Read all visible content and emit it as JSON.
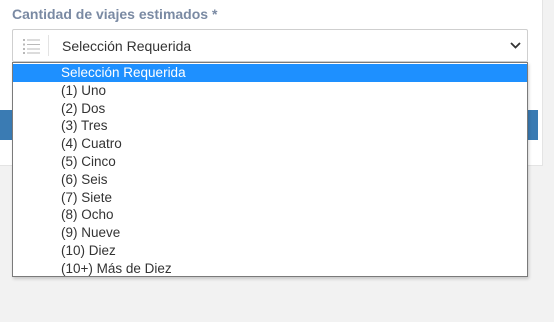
{
  "form": {
    "label": "Cantidad de viajes estimados *",
    "select": {
      "value": "Selección Requerida",
      "icon": "list-icon",
      "options": [
        "Selección Requerida",
        "(1) Uno",
        "(2) Dos",
        "(3) Tres",
        "(4) Cuatro",
        "(5) Cinco",
        "(6) Seis",
        "(7) Siete",
        "(8) Ocho",
        "(9) Nueve",
        "(10) Diez",
        "(10+) Más de Diez"
      ],
      "highlighted_index": 0
    }
  },
  "colors": {
    "highlight": "#1e90ff",
    "label": "#7a8aa3",
    "button": "#3a7bb3"
  }
}
